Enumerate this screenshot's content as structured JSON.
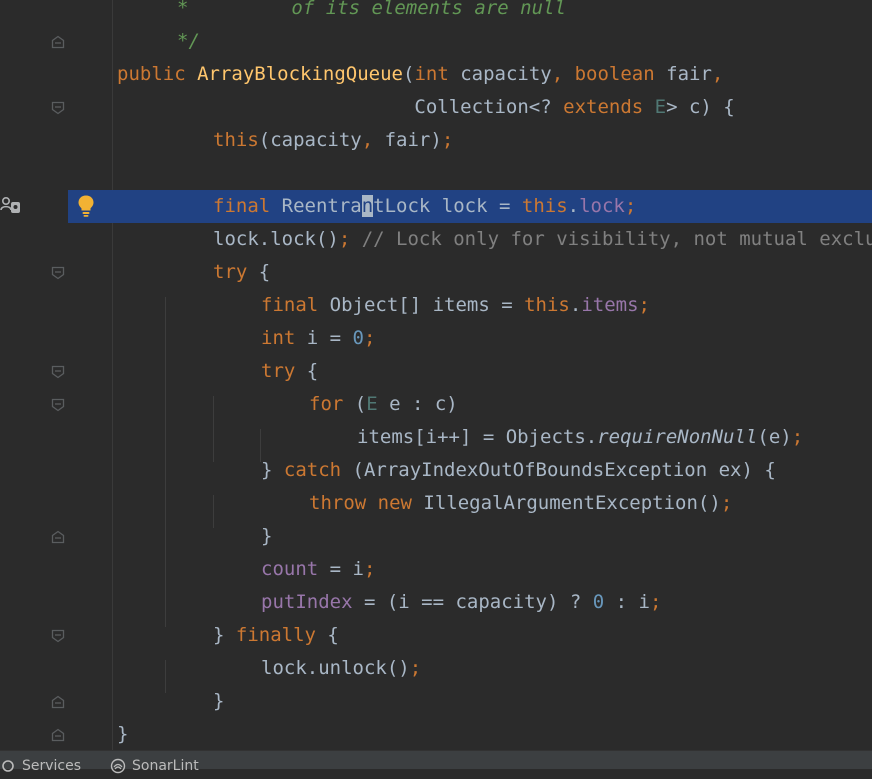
{
  "editor": {
    "lines": [
      {
        "indent": 1,
        "tokens": [
          {
            "t": "*         ",
            "c": "doc"
          },
          {
            "t": "of its elements are null",
            "c": "doc"
          }
        ]
      },
      {
        "indent": 1,
        "tokens": [
          {
            "t": "*/",
            "c": "doc"
          }
        ]
      },
      {
        "indent": 0,
        "tokens": [
          {
            "t": "public ",
            "c": "kw"
          },
          {
            "t": "ArrayBlockingQueue",
            "c": "fn"
          },
          {
            "t": "(",
            "c": ""
          },
          {
            "t": "int ",
            "c": "kw"
          },
          {
            "t": "capacity",
            "c": ""
          },
          {
            "t": ", ",
            "c": "kw"
          },
          {
            "t": "boolean ",
            "c": "kw"
          },
          {
            "t": "fair",
            "c": ""
          },
          {
            "t": ",",
            "c": "kw"
          }
        ]
      },
      {
        "indent": 0,
        "pad": "                          ",
        "tokens": [
          {
            "t": "Collection<? ",
            "c": ""
          },
          {
            "t": "extends ",
            "c": "kw"
          },
          {
            "t": "E",
            "c": "gen"
          },
          {
            "t": "> c) {",
            "c": ""
          }
        ]
      },
      {
        "indent": 2,
        "tokens": [
          {
            "t": "this",
            "c": "kw"
          },
          {
            "t": "(capacity",
            "c": ""
          },
          {
            "t": ", ",
            "c": "kw"
          },
          {
            "t": "fair)",
            "c": ""
          },
          {
            "t": ";",
            "c": "kw"
          }
        ]
      },
      {
        "indent": 0,
        "tokens": []
      },
      {
        "indent": 2,
        "current": true,
        "tokens": [
          {
            "t": "final ",
            "c": "kw"
          },
          {
            "t": "Reentra",
            "c": ""
          },
          {
            "t": "n",
            "c": "caret"
          },
          {
            "t": "tLock lock = ",
            "c": ""
          },
          {
            "t": "this",
            "c": "kw"
          },
          {
            "t": ".",
            "c": ""
          },
          {
            "t": "lock",
            "c": "fld"
          },
          {
            "t": ";",
            "c": "kw"
          }
        ]
      },
      {
        "indent": 2,
        "tokens": [
          {
            "t": "lock.lock()",
            "c": ""
          },
          {
            "t": "; ",
            "c": "kw"
          },
          {
            "t": "// Lock only for visibility, not mutual exclus",
            "c": "cmt"
          }
        ]
      },
      {
        "indent": 2,
        "tokens": [
          {
            "t": "try ",
            "c": "kw"
          },
          {
            "t": "{",
            "c": ""
          }
        ]
      },
      {
        "indent": 3,
        "tokens": [
          {
            "t": "final ",
            "c": "kw"
          },
          {
            "t": "Object[] items = ",
            "c": ""
          },
          {
            "t": "this",
            "c": "kw"
          },
          {
            "t": ".",
            "c": ""
          },
          {
            "t": "items",
            "c": "fld"
          },
          {
            "t": ";",
            "c": "kw"
          }
        ]
      },
      {
        "indent": 3,
        "tokens": [
          {
            "t": "int ",
            "c": "kw"
          },
          {
            "t": "i = ",
            "c": ""
          },
          {
            "t": "0",
            "c": "num"
          },
          {
            "t": ";",
            "c": "kw"
          }
        ]
      },
      {
        "indent": 3,
        "tokens": [
          {
            "t": "try ",
            "c": "kw"
          },
          {
            "t": "{",
            "c": ""
          }
        ]
      },
      {
        "indent": 4,
        "tokens": [
          {
            "t": "for ",
            "c": "kw"
          },
          {
            "t": "(",
            "c": ""
          },
          {
            "t": "E",
            "c": "gen"
          },
          {
            "t": " e : c)",
            "c": ""
          }
        ]
      },
      {
        "indent": 5,
        "tokens": [
          {
            "t": "items[i++] = Objects.",
            "c": ""
          },
          {
            "t": "requireNonNull",
            "c": "ital"
          },
          {
            "t": "(e)",
            "c": ""
          },
          {
            "t": ";",
            "c": "kw"
          }
        ]
      },
      {
        "indent": 3,
        "tokens": [
          {
            "t": "} ",
            "c": ""
          },
          {
            "t": "catch ",
            "c": "kw"
          },
          {
            "t": "(ArrayIndexOutOfBoundsException ex) {",
            "c": ""
          }
        ]
      },
      {
        "indent": 4,
        "tokens": [
          {
            "t": "throw new ",
            "c": "kw"
          },
          {
            "t": "IllegalArgumentException()",
            "c": ""
          },
          {
            "t": ";",
            "c": "kw"
          }
        ]
      },
      {
        "indent": 3,
        "tokens": [
          {
            "t": "}",
            "c": ""
          }
        ]
      },
      {
        "indent": 3,
        "tokens": [
          {
            "t": "count",
            "c": "fld"
          },
          {
            "t": " = i",
            "c": ""
          },
          {
            "t": ";",
            "c": "kw"
          }
        ]
      },
      {
        "indent": 3,
        "tokens": [
          {
            "t": "putIndex",
            "c": "fld"
          },
          {
            "t": " = (i == capacity) ? ",
            "c": ""
          },
          {
            "t": "0",
            "c": "num"
          },
          {
            "t": " : i",
            "c": ""
          },
          {
            "t": ";",
            "c": "kw"
          }
        ]
      },
      {
        "indent": 2,
        "tokens": [
          {
            "t": "} ",
            "c": ""
          },
          {
            "t": "finally ",
            "c": "kw"
          },
          {
            "t": "{",
            "c": ""
          }
        ]
      },
      {
        "indent": 3,
        "tokens": [
          {
            "t": "lock.unlock()",
            "c": ""
          },
          {
            "t": ";",
            "c": "kw"
          }
        ]
      },
      {
        "indent": 2,
        "tokens": [
          {
            "t": "}",
            "c": ""
          }
        ]
      },
      {
        "indent": 0,
        "tokens": [
          {
            "t": "}",
            "c": ""
          }
        ]
      }
    ],
    "fold_markers": [
      {
        "line": 1,
        "dir": "end"
      },
      {
        "line": 3,
        "dir": "start"
      },
      {
        "line": 8,
        "dir": "start"
      },
      {
        "line": 11,
        "dir": "start"
      },
      {
        "line": 12,
        "dir": "start"
      },
      {
        "line": 16,
        "dir": "end"
      },
      {
        "line": 19,
        "dir": "start"
      },
      {
        "line": 21,
        "dir": "end"
      },
      {
        "line": 22,
        "dir": "end"
      }
    ],
    "gutter_icons": {
      "intention": "lightbulb-icon",
      "left_tool": "people-search-icon"
    }
  },
  "statusbar": {
    "services_label": "Services",
    "sonarlint_label": "SonarLint"
  },
  "colors": {
    "background": "#2b2b2b",
    "current_line": "#214283",
    "keyword": "#cc7832",
    "function": "#ffc66d",
    "field": "#9876aa",
    "number": "#6897bb",
    "comment": "#808080",
    "doc_comment": "#629755",
    "text": "#a9b7c6"
  }
}
